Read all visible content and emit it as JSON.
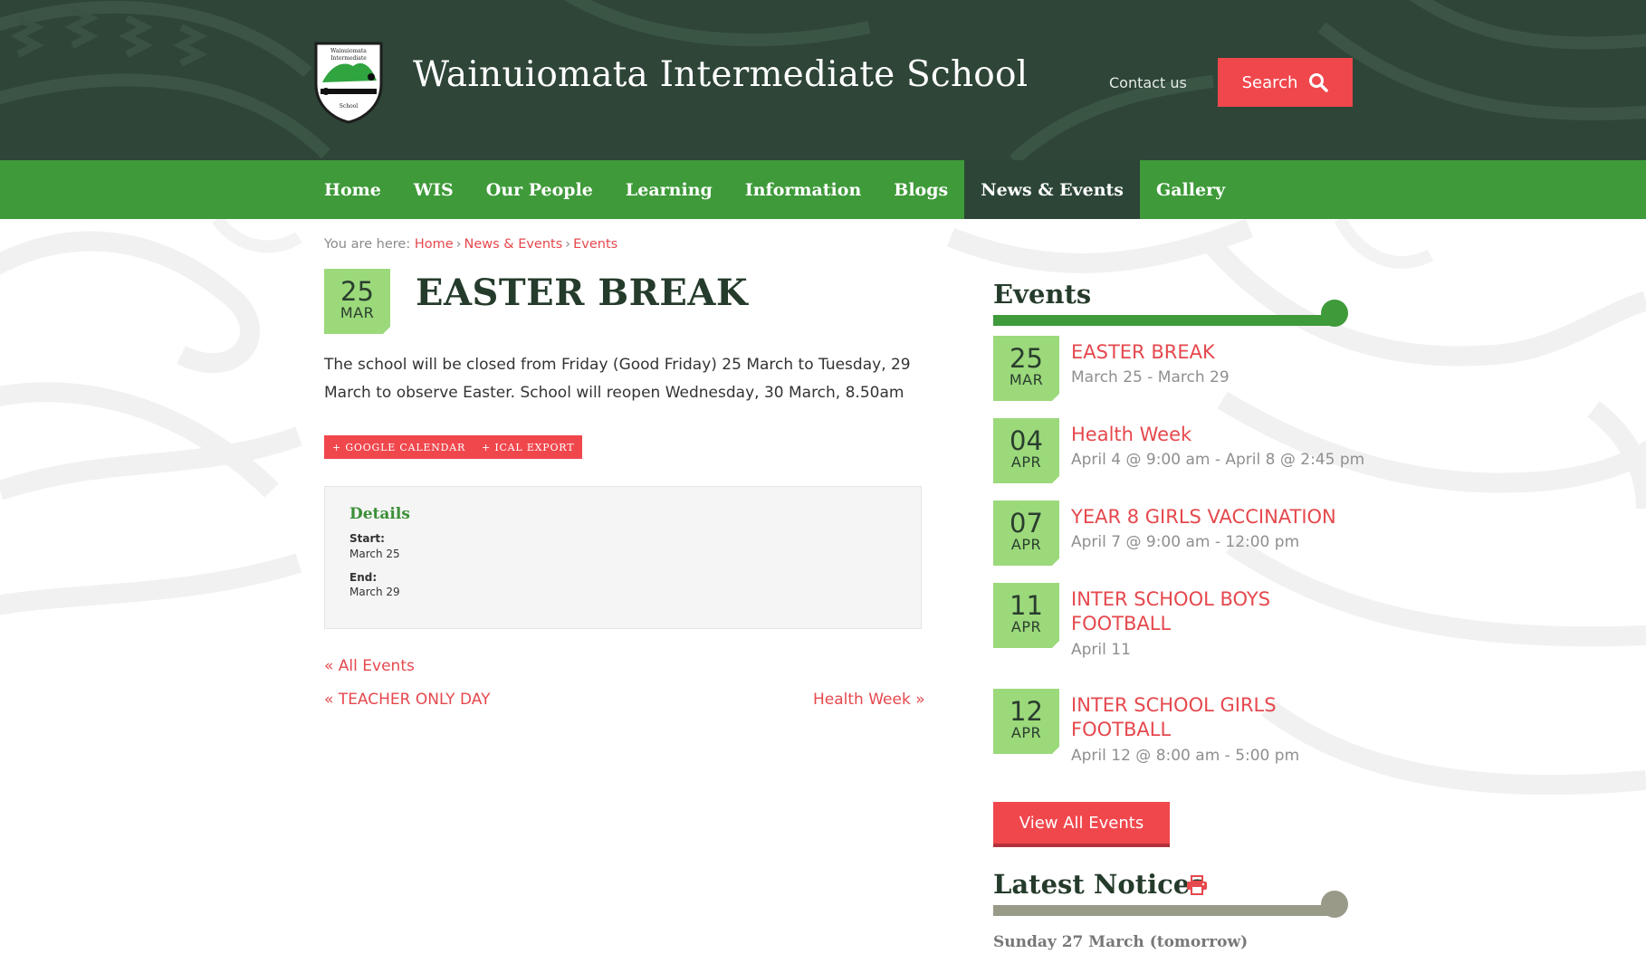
{
  "header": {
    "site_title": "Wainuiomata Intermediate School",
    "logo_text_1": "Wainuiomata",
    "logo_text_2": "Intermediate",
    "logo_text_3": "School",
    "contact_label": "Contact us",
    "search_label": "Search"
  },
  "nav": {
    "items": [
      "Home",
      "WIS",
      "Our People",
      "Learning",
      "Information",
      "Blogs",
      "News & Events",
      "Gallery"
    ],
    "active": "News & Events"
  },
  "breadcrumb": {
    "prefix": "You are here:",
    "items": [
      "Home",
      "News & Events",
      "Events"
    ],
    "separator": "›"
  },
  "event": {
    "day": "25",
    "month": "MAR",
    "title": "EASTER BREAK",
    "description": "The school will be closed from Friday (Good Friday) 25 March to Tuesday, 29 March to observe Easter.  School will reopen Wednesday, 30 March, 8.50am",
    "google_calendar_label": "+ GOOGLE CALENDAR",
    "ical_label": "+ ICAL EXPORT",
    "details": {
      "heading": "Details",
      "start_label": "Start:",
      "start_value": "March 25",
      "end_label": "End:",
      "end_value": "March 29"
    },
    "all_events_label": "« All Events",
    "prev_label": "« TEACHER ONLY DAY",
    "next_label": "Health Week »"
  },
  "sidebar": {
    "events_heading": "Events",
    "events": [
      {
        "day": "25",
        "month": "MAR",
        "title": "EASTER BREAK",
        "time": "March 25 - March 29"
      },
      {
        "day": "04",
        "month": "APR",
        "title": "Health Week",
        "time": "April 4 @ 9:00 am - April 8 @ 2:45 pm"
      },
      {
        "day": "07",
        "month": "APR",
        "title": "YEAR 8 GIRLS VACCINATION",
        "time": "April 7 @ 9:00 am - 12:00 pm"
      },
      {
        "day": "11",
        "month": "APR",
        "title": "INTER SCHOOL BOYS FOOTBALL",
        "time": "April 11"
      },
      {
        "day": "12",
        "month": "APR",
        "title": "INTER SCHOOL GIRLS FOOTBALL",
        "time": "April 12 @ 8:00 am - 5:00 pm"
      }
    ],
    "view_all_label": "View All Events",
    "notices_heading": "Latest Notices",
    "notice_date": "Sunday 27 March (tomorrow)"
  },
  "colors": {
    "header_bg": "#2e4538",
    "nav_bg": "#3f9a3a",
    "nav_active": "#2c4537",
    "accent_red": "#f0474d",
    "date_tile": "#9bd97b",
    "events_bar": "#3f9a3a",
    "notices_bar": "#9a9a88"
  },
  "icons": {
    "search": "magnifier-icon",
    "print": "printer-icon"
  }
}
